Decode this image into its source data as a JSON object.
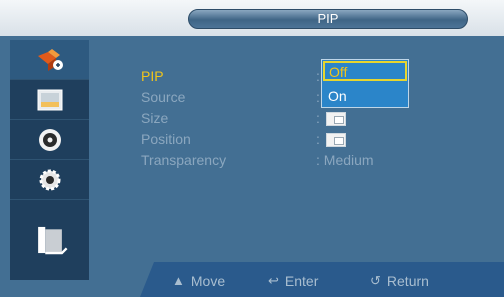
{
  "title": "PIP",
  "sidebar": {
    "items": [
      {
        "icon": "picture-icon"
      },
      {
        "icon": "display-icon"
      },
      {
        "icon": "sound-icon"
      },
      {
        "icon": "setup-icon"
      },
      {
        "icon": "multi-control-icon"
      }
    ]
  },
  "settings": {
    "pip_label": "PIP",
    "source_label": "Source",
    "size_label": "Size",
    "position_label": "Position",
    "transparency_label": "Transparency",
    "colon": ":",
    "transparency_value": "Medium"
  },
  "dropdown": {
    "options": [
      "Off",
      "On"
    ],
    "selected": "Off"
  },
  "footer": {
    "move_icon": "up-down-arrow-icon",
    "move_label": "Move",
    "enter_icon": "enter-icon",
    "enter_label": "Enter",
    "return_icon": "return-icon",
    "return_label": "Return"
  },
  "colors": {
    "background": "#436f93",
    "sidebar": "#1f3f5d",
    "highlight": "#f1c419",
    "dropdown": "#2b85c9"
  }
}
